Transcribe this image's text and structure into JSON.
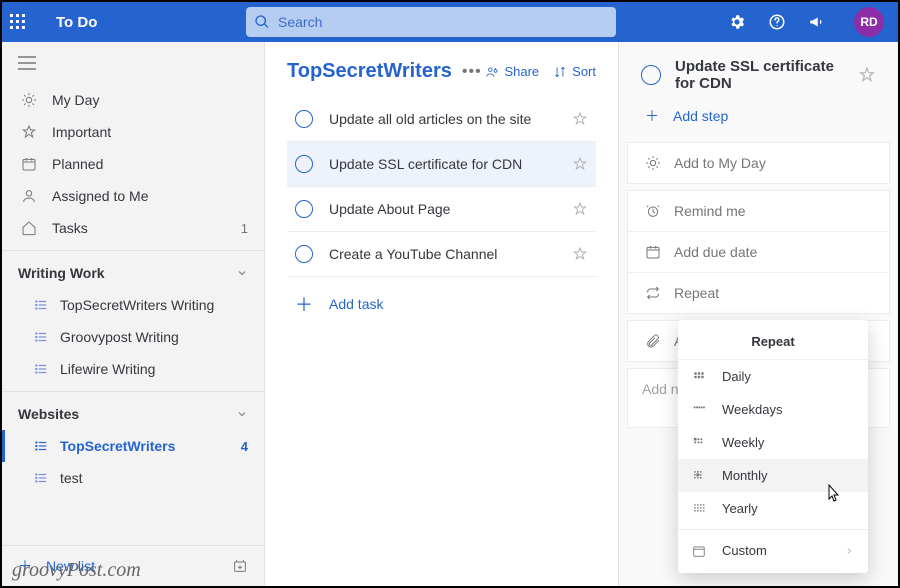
{
  "header": {
    "brand": "To Do",
    "searchPlaceholder": "Search",
    "avatar": "RD"
  },
  "sidebar": {
    "smart": [
      {
        "name": "myday",
        "label": "My Day",
        "count": ""
      },
      {
        "name": "important",
        "label": "Important",
        "count": ""
      },
      {
        "name": "planned",
        "label": "Planned",
        "count": ""
      },
      {
        "name": "assigned",
        "label": "Assigned to Me",
        "count": ""
      },
      {
        "name": "tasks",
        "label": "Tasks",
        "count": "1"
      }
    ],
    "groups": [
      {
        "name": "Writing Work",
        "lists": [
          {
            "label": "TopSecretWriters Writing",
            "count": ""
          },
          {
            "label": "Groovypost Writing",
            "count": ""
          },
          {
            "label": "Lifewire Writing",
            "count": ""
          }
        ]
      },
      {
        "name": "Websites",
        "lists": [
          {
            "label": "TopSecretWriters",
            "count": "4",
            "active": true
          },
          {
            "label": "test",
            "count": ""
          }
        ]
      }
    ],
    "newList": "New list"
  },
  "main": {
    "title": "TopSecretWriters",
    "share": "Share",
    "sort": "Sort",
    "tasks": [
      {
        "label": "Update all old articles on the site"
      },
      {
        "label": "Update SSL certificate for CDN",
        "selected": true
      },
      {
        "label": "Update About Page"
      },
      {
        "label": "Create a YouTube Channel"
      }
    ],
    "addTask": "Add task"
  },
  "detail": {
    "title": "Update SSL certificate for CDN",
    "addStep": "Add step",
    "addToMyDay": "Add to My Day",
    "remindMe": "Remind me",
    "addDueDate": "Add due date",
    "repeat": "Repeat",
    "addFile": "Add",
    "addNote": "Add note"
  },
  "repeatPopup": {
    "title": "Repeat",
    "items": [
      {
        "label": "Daily"
      },
      {
        "label": "Weekdays"
      },
      {
        "label": "Weekly"
      },
      {
        "label": "Monthly",
        "hl": true
      },
      {
        "label": "Yearly"
      }
    ],
    "custom": "Custom"
  },
  "watermark": "groovyPost.com"
}
